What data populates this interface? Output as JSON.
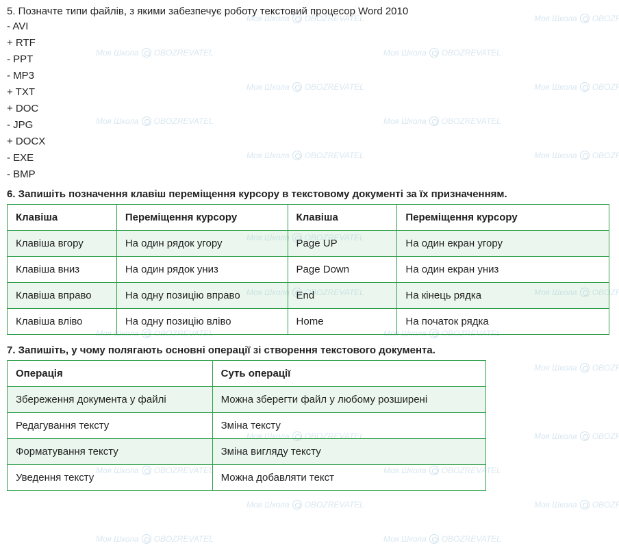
{
  "q5": {
    "title": "5. Позначте типи файлів, з якими забезпечує роботу текстовий процесор Word 2010",
    "options": [
      "- AVI",
      "+ RTF",
      "- PPT",
      "- MP3",
      "+ TXT",
      "+ DOC",
      "- JPG",
      "+ DOCX",
      "- EXE",
      "- BMP"
    ]
  },
  "q6": {
    "title": "6. Запишіть позначення клавіш переміщення курсору в текстовому документі за їх призначенням.",
    "headers": [
      "Клавіша",
      "Переміщення курсору",
      "Клавіша",
      "Переміщення курсору"
    ],
    "rows": [
      [
        "Клавіша вгору",
        "На один рядок угору",
        "Page UP",
        "На один екран угору"
      ],
      [
        "Клавіша вниз",
        "На один рядок униз",
        "Page Down",
        "На один екран униз"
      ],
      [
        "Клавіша вправо",
        "На одну позицію вправо",
        "End",
        "На кінець рядка"
      ],
      [
        "Клавіша вліво",
        "На одну позицію вліво",
        "Home",
        "На початок рядка"
      ]
    ]
  },
  "q7": {
    "title": "7. Запишіть, у чому полягають основні операції зі створення текстового документа.",
    "headers": [
      "Операція",
      "Суть операції"
    ],
    "rows": [
      [
        "Збереження документа у файлі",
        "Можна зберегти файл у любому розширені"
      ],
      [
        "Редагування тексту",
        "Зміна тексту"
      ],
      [
        "Форматування тексту",
        "Зміна вигляду тексту"
      ],
      [
        "Уведення тексту",
        "Можна добавляти текст"
      ]
    ]
  },
  "watermark": {
    "text1": "Моя Школа",
    "text2": "OBOZREVATEL"
  }
}
